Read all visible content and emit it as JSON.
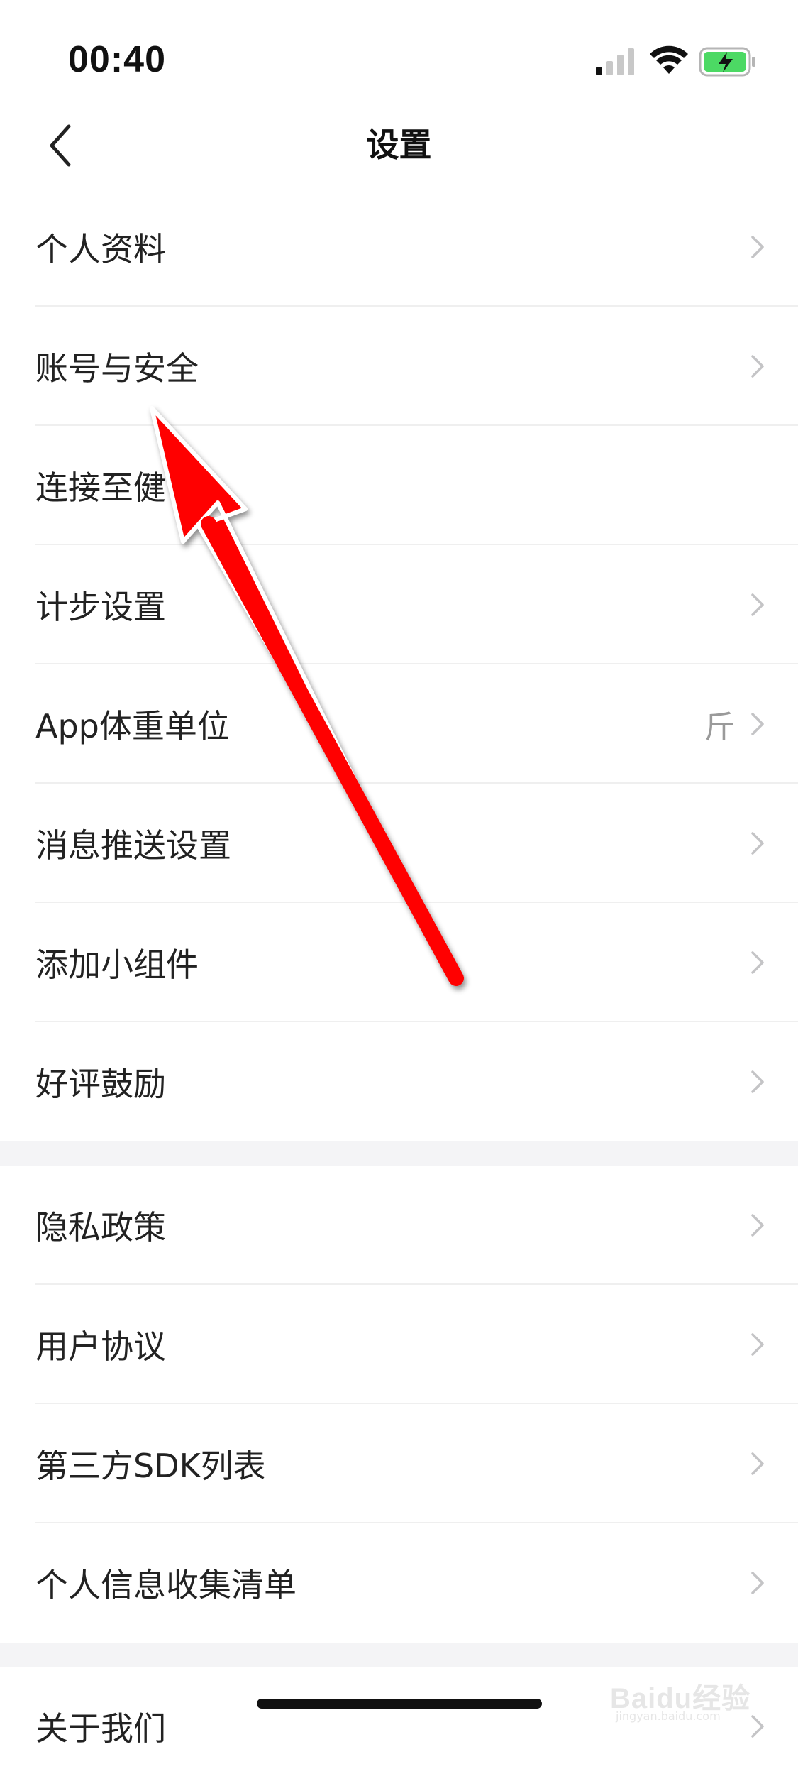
{
  "status_bar": {
    "time": "00:40",
    "signal_icon": "cellular-signal-icon",
    "wifi_icon": "wifi-icon",
    "battery_icon": "battery-charging-icon",
    "battery_color": "#4cd964"
  },
  "nav": {
    "title": "设置",
    "back_icon": "chevron-left-icon"
  },
  "sections": [
    {
      "items": [
        {
          "label": "个人资料",
          "value": ""
        },
        {
          "label": "账号与安全",
          "value": ""
        },
        {
          "label": "连接至健",
          "value": ""
        },
        {
          "label": "计步设置",
          "value": ""
        },
        {
          "label": "App体重单位",
          "value": "斤"
        },
        {
          "label": "消息推送设置",
          "value": ""
        },
        {
          "label": "添加小组件",
          "value": ""
        },
        {
          "label": "好评鼓励",
          "value": ""
        }
      ]
    },
    {
      "items": [
        {
          "label": "隐私政策",
          "value": ""
        },
        {
          "label": "用户协议",
          "value": ""
        },
        {
          "label": "第三方SDK列表",
          "value": ""
        },
        {
          "label": "个人信息收集清单",
          "value": ""
        }
      ]
    },
    {
      "items": [
        {
          "label": "关于我们",
          "value": ""
        }
      ]
    }
  ],
  "annotation": {
    "type": "red-arrow-icon",
    "color": "#ff0000"
  },
  "watermark": {
    "text": "Baidu经验",
    "sub": "jingyan.baidu.com"
  },
  "colors": {
    "separator": "#efefef",
    "section_gap": "#f4f4f6",
    "secondary_text": "#9a9a9a",
    "chevron": "#c4c4c6"
  }
}
